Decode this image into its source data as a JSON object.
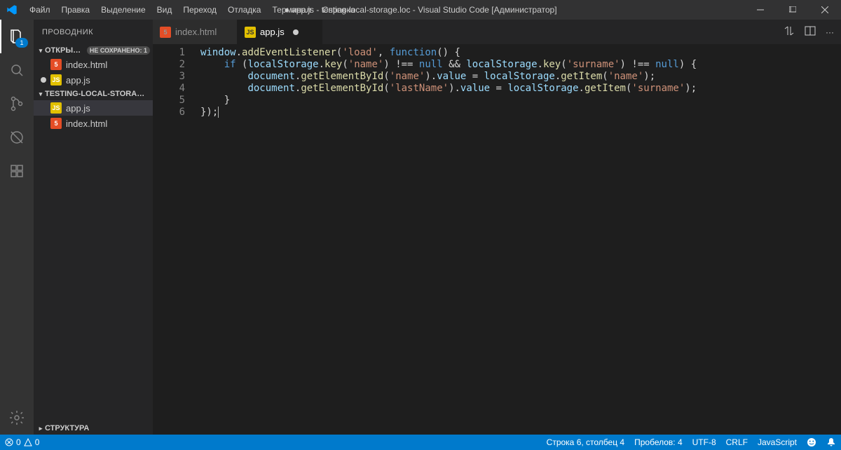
{
  "title": "● app.js - testing-local-storage.loc - Visual Studio Code [Администратор]",
  "menu": [
    "Файл",
    "Правка",
    "Выделение",
    "Вид",
    "Переход",
    "Отладка",
    "Терминал",
    "Справка"
  ],
  "activity": {
    "explorer_badge": "1"
  },
  "sidebar": {
    "title": "ПРОВОДНИК",
    "open_editors": {
      "label": "ОТКРЫТЫЕ Р...",
      "unsaved": "НЕ СОХРАНЕНО: 1",
      "items": [
        {
          "icon": "html",
          "name": "index.html",
          "modified": false
        },
        {
          "icon": "js",
          "name": "app.js",
          "modified": true
        }
      ]
    },
    "project": {
      "label": "TESTING-LOCAL-STORAGE.LOC",
      "items": [
        {
          "icon": "js",
          "name": "app.js",
          "active": true
        },
        {
          "icon": "html",
          "name": "index.html"
        }
      ]
    },
    "outline": {
      "label": "СТРУКТУРА"
    }
  },
  "tabs": [
    {
      "icon": "html",
      "name": "index.html",
      "active": false,
      "modified": false
    },
    {
      "icon": "js",
      "name": "app.js",
      "active": true,
      "modified": true
    }
  ],
  "code": {
    "line_numbers": [
      "1",
      "2",
      "3",
      "4",
      "5",
      "6"
    ],
    "lines": [
      {
        "t": [
          [
            "v",
            "window"
          ],
          [
            "p",
            "."
          ],
          [
            "f",
            "addEventListener"
          ],
          [
            "p",
            "("
          ],
          [
            "s",
            "'load'"
          ],
          [
            "p",
            ", "
          ],
          [
            "k",
            "function"
          ],
          [
            "p",
            "() {"
          ]
        ]
      },
      {
        "t": [
          [
            "p",
            "    "
          ],
          [
            "k",
            "if"
          ],
          [
            "p",
            " ("
          ],
          [
            "v",
            "localStorage"
          ],
          [
            "p",
            "."
          ],
          [
            "f",
            "key"
          ],
          [
            "p",
            "("
          ],
          [
            "s",
            "'name'"
          ],
          [
            "p",
            ") !== "
          ],
          [
            "k",
            "null"
          ],
          [
            "p",
            " && "
          ],
          [
            "v",
            "localStorage"
          ],
          [
            "p",
            "."
          ],
          [
            "f",
            "key"
          ],
          [
            "p",
            "("
          ],
          [
            "s",
            "'surname'"
          ],
          [
            "p",
            ") !== "
          ],
          [
            "k",
            "null"
          ],
          [
            "p",
            ") {"
          ]
        ]
      },
      {
        "t": [
          [
            "p",
            "        "
          ],
          [
            "v",
            "document"
          ],
          [
            "p",
            "."
          ],
          [
            "f",
            "getElementById"
          ],
          [
            "p",
            "("
          ],
          [
            "s",
            "'name'"
          ],
          [
            "p",
            ")."
          ],
          [
            "v",
            "value"
          ],
          [
            "p",
            " = "
          ],
          [
            "v",
            "localStorage"
          ],
          [
            "p",
            "."
          ],
          [
            "f",
            "getItem"
          ],
          [
            "p",
            "("
          ],
          [
            "s",
            "'name'"
          ],
          [
            "p",
            ");"
          ]
        ]
      },
      {
        "t": [
          [
            "p",
            "        "
          ],
          [
            "v",
            "document"
          ],
          [
            "p",
            "."
          ],
          [
            "f",
            "getElementById"
          ],
          [
            "p",
            "("
          ],
          [
            "s",
            "'lastName'"
          ],
          [
            "p",
            ")."
          ],
          [
            "v",
            "value"
          ],
          [
            "p",
            " = "
          ],
          [
            "v",
            "localStorage"
          ],
          [
            "p",
            "."
          ],
          [
            "f",
            "getItem"
          ],
          [
            "p",
            "("
          ],
          [
            "s",
            "'surname'"
          ],
          [
            "p",
            ");"
          ]
        ]
      },
      {
        "t": [
          [
            "p",
            "    }"
          ]
        ]
      },
      {
        "t": [
          [
            "p",
            "});"
          ]
        ],
        "cursor": true
      }
    ]
  },
  "status": {
    "errors": "0",
    "warnings": "0",
    "cursor": "Строка 6, столбец 4",
    "spaces": "Пробелов: 4",
    "encoding": "UTF-8",
    "eol": "CRLF",
    "lang": "JavaScript"
  },
  "icons": {
    "html": "5",
    "js": "JS"
  }
}
